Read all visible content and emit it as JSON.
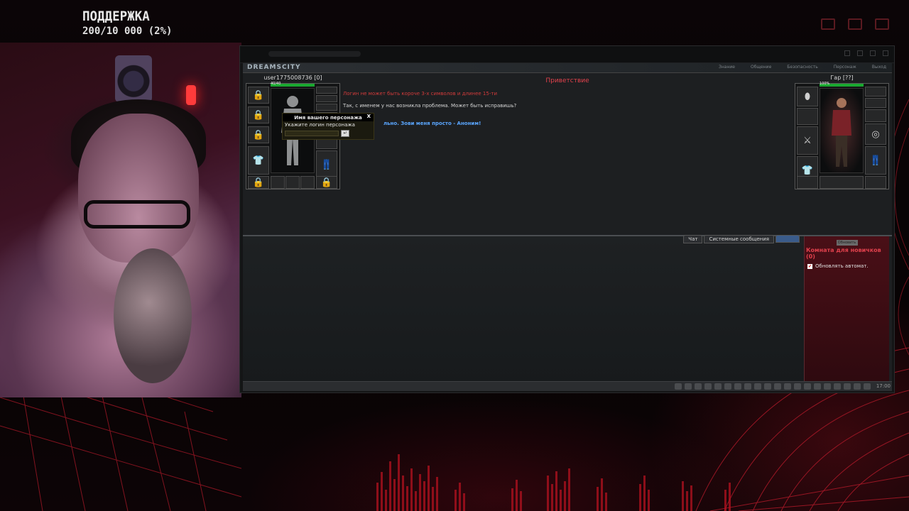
{
  "support": {
    "title": "ПОДДЕРЖКА",
    "progress_text": "200/10 000 (2%)",
    "progress_fraction": 0.02
  },
  "game": {
    "logo": "DREAMSCITY",
    "nav": [
      "Знание",
      "Общение",
      "Безопасность",
      "Персонаж",
      "Выход"
    ],
    "left_character": {
      "name": "user1775008736 [0]",
      "hp_text": "40/40"
    },
    "right_character": {
      "name": "Гар [??]",
      "hp_text": "100%"
    },
    "center_title": "Приветствие",
    "error_message": "Логин не может быть короче 3-х символов и длинее 15-ти",
    "dialog_text": "Так, с именем у нас возникла проблема. Может быть исправишь?",
    "blue_text": "льно. Зови меня просто - Аноним!",
    "popup": {
      "title": "Имя вашего персонажа",
      "close": "X",
      "label": "Укажите логин персонажа",
      "input_value": ""
    },
    "chat_tabs": [
      "Чат",
      "Системные сообщения",
      ""
    ],
    "room": {
      "refresh": "Обновить",
      "title": "Комната для новичков (0)",
      "auto_update": "Обновлять автомат.",
      "auto_update_checked": true
    },
    "time": "17:00"
  },
  "colors": {
    "accent_red": "#e2424c",
    "link_blue": "#5aa6ff",
    "hp_green": "#1aa830"
  }
}
